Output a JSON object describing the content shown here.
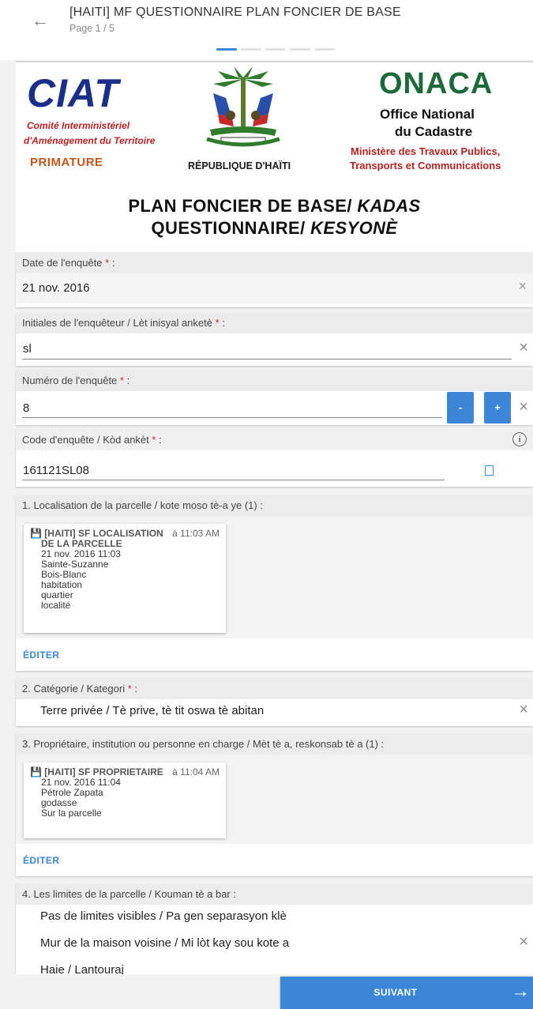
{
  "header": {
    "title": "[HAITI] MF QUESTIONNAIRE PLAN FONCIER DE BASE",
    "page_indicator": "Page 1 / 5",
    "back_icon": "arrow-left-icon"
  },
  "logos": {
    "ciat": "CIAT",
    "ciat_sub1": "Comité Interministériel",
    "ciat_sub2": "d'Aménagement du Territoire",
    "primature": "PRIMATURE",
    "republique": "RÉPUBLIQUE D'HAÏTI",
    "onaca": "ONACA",
    "onaca_sub1": "Office National",
    "onaca_sub2": "du Cadastre",
    "ministere1": "Ministère des Travaux Publics,",
    "ministere2": "Transports et Communications",
    "plan_title_1a": "PLAN FONCIER DE BASE/",
    "plan_title_1b": "KADAS",
    "plan_title_2a": "QUESTIONNAIRE/",
    "plan_title_2b": "KESYONÈ"
  },
  "fields": {
    "date": {
      "label": "Date de l'enquête",
      "required_mark": "*",
      "suffix": ":",
      "value": "21 nov. 2016"
    },
    "initials": {
      "label": "Initiales de l'enquêteur / Lèt inisyal anketè",
      "required_mark": "*",
      "suffix": ":",
      "value": "sl"
    },
    "number": {
      "label": "Numéro de l'enquête",
      "required_mark": "*",
      "suffix": ":",
      "value": "8",
      "minus": "-",
      "plus": "+"
    },
    "code": {
      "label": "Code d'enquête / Kòd ankèt",
      "required_mark": "*",
      "suffix": ":",
      "value": "161121SL08",
      "info": "i"
    }
  },
  "location": {
    "label": "1. Localisation de la parcelle / kote moso tè-a ye (1) :",
    "record": {
      "title_1": "[HAITI]  SF LOCALISATION",
      "title_2": "DE LA PARCELLE",
      "time": "à 11:03 AM",
      "lines": [
        "21 nov. 2016 11:03",
        "Sainte-Suzanne",
        "Bois-Blanc",
        "habitation",
        "quartier",
        "localité"
      ]
    },
    "edit": "ÉDITER"
  },
  "category": {
    "label": "2. Catégorie / Kategori",
    "required_mark": "*",
    "suffix": ":",
    "value": "Terre privée / Tè prive, tè tit oswa tè abitan"
  },
  "owner": {
    "label": "3. Propriétaire, institution ou personne en charge / Mèt tè a, reskonsab tè a (1) :",
    "record": {
      "title": "[HAITI] SF PROPRIETAIRE",
      "time": "à 11:04 AM",
      "lines": [
        "21 nov. 2016 11:04",
        "Pétrole Zapata",
        "godasse",
        "Sur la parcelle"
      ]
    },
    "edit": "ÉDITER"
  },
  "limits": {
    "label": "4. Les limites de la parcelle / Kouman tè a bar :",
    "options": [
      "Pas de limites visibles / Pa gen separasyon klè",
      "Mur de la maison voisine / Mi lòt kay sou kote a",
      "Haie / Lantouraj"
    ]
  },
  "footer": {
    "next_label": "SUIVANT",
    "next_icon": "arrow-right-icon"
  },
  "colors": {
    "accent": "#3b86d6",
    "required": "#e02020",
    "ciat_blue": "#1a2f8c",
    "onaca_green": "#1b6b3a"
  }
}
